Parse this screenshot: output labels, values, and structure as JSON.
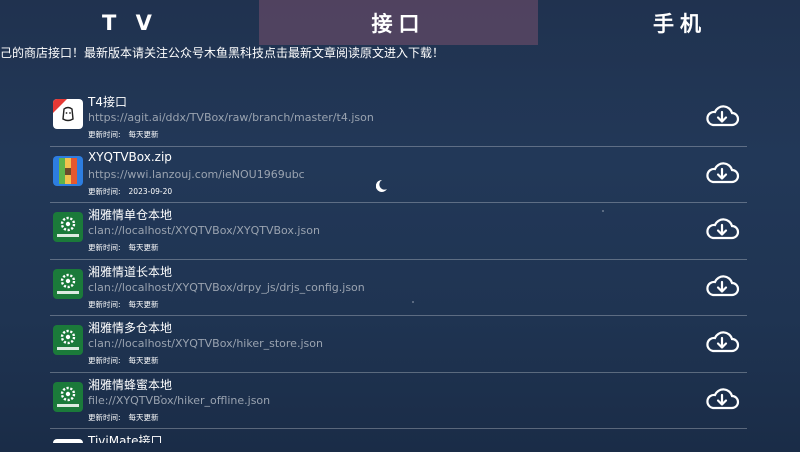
{
  "tabs": [
    {
      "label": "T V"
    },
    {
      "label": "接口"
    },
    {
      "label": "手机"
    }
  ],
  "notice": "己的商店接口！最新版本请关注公众号木鱼黑科技点击最新文章阅读原文进入下载！",
  "update_label": "更新时间:",
  "items": [
    {
      "title": "T4接口",
      "url": "https://agit.ai/ddx/TVBox/raw/branch/master/t4.json",
      "update": "每天更新",
      "icon": "t4-app-icon"
    },
    {
      "title": "XYQTVBox.zip",
      "url": "https://wwi.lanzouj.com/ieNOU1969ubc",
      "update": "2023-09-20",
      "icon": "zip-archive-icon"
    },
    {
      "title": "湘雅情单仓本地",
      "url": "clan://localhost/XYQTVBox/XYQTVBox.json",
      "update": "每天更新",
      "icon": "gear-app-icon"
    },
    {
      "title": "湘雅情道长本地",
      "url": "clan://localhost/XYQTVBox/drpy_js/drjs_config.json",
      "update": "每天更新",
      "icon": "gear-app-icon"
    },
    {
      "title": "湘雅情多仓本地",
      "url": "clan://localhost/XYQTVBox/hiker_store.json",
      "update": "每天更新",
      "icon": "gear-app-icon"
    },
    {
      "title": "湘雅情蜂蜜本地",
      "url": "file://XYQTVBox/hiker_offline.json",
      "update": "每天更新",
      "icon": "gear-app-icon"
    }
  ],
  "partial_item": {
    "title": "TiviMate接口"
  },
  "colors": {
    "accent_tab": "#7a5070",
    "background": "#213656",
    "url_text": "#9aa3b0"
  }
}
